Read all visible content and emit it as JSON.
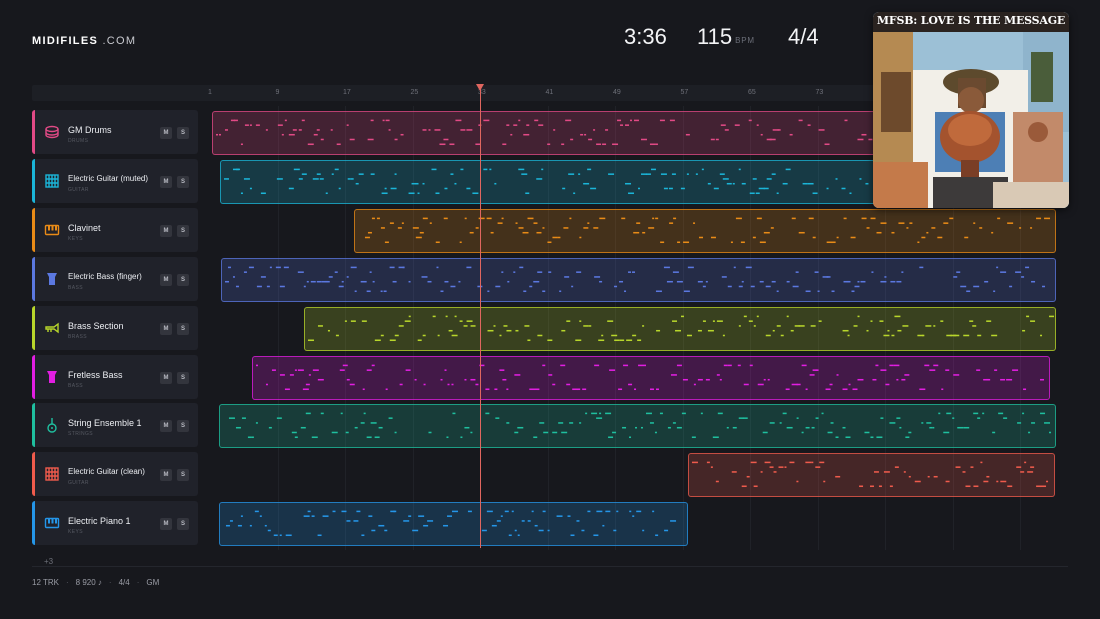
{
  "brand": {
    "name": "MIDIFILES",
    "tld": ".COM"
  },
  "transport": {
    "time": "3:36",
    "bpm": "115",
    "bpm_unit": "BPM",
    "time_signature": "4/4"
  },
  "ruler": {
    "ticks": [
      "1",
      "9",
      "17",
      "25",
      "33",
      "41",
      "49",
      "57",
      "65",
      "73"
    ]
  },
  "playhead": {
    "bar": 33
  },
  "tracks": [
    {
      "name": "GM Drums",
      "category": "DRUMS",
      "color": "#e24a86",
      "icon": "drum-icon",
      "mute": "M",
      "solo": "S"
    },
    {
      "name": "Electric Guitar (muted)",
      "category": "GUITAR",
      "color": "#1bb5d8",
      "icon": "guitar-icon",
      "mute": "M",
      "solo": "S"
    },
    {
      "name": "Clavinet",
      "category": "KEYS",
      "color": "#e98b17",
      "icon": "keys-icon",
      "mute": "M",
      "solo": "S"
    },
    {
      "name": "Electric Bass (finger)",
      "category": "BASS",
      "color": "#5b78e0",
      "icon": "bass-icon",
      "mute": "M",
      "solo": "S"
    },
    {
      "name": "Brass Section",
      "category": "BRASS",
      "color": "#b8d62b",
      "icon": "trumpet-icon",
      "mute": "M",
      "solo": "S"
    },
    {
      "name": "Fretless Bass",
      "category": "BASS",
      "color": "#e21ee2",
      "icon": "bass-icon",
      "mute": "M",
      "solo": "S"
    },
    {
      "name": "String Ensemble 1",
      "category": "STRINGS",
      "color": "#1fbf9f",
      "icon": "violin-icon",
      "mute": "M",
      "solo": "S"
    },
    {
      "name": "Electric Guitar (clean)",
      "category": "GUITAR",
      "color": "#ef5b4c",
      "icon": "guitar-icon",
      "mute": "M",
      "solo": "S"
    },
    {
      "name": "Electric Piano 1",
      "category": "KEYS",
      "color": "#2596e8",
      "icon": "keys-icon",
      "mute": "M",
      "solo": "S"
    }
  ],
  "more_tracks": "+3",
  "footer": {
    "tracks": "12 TRK",
    "notes": "8 920 ♪",
    "time_signature": "4/4",
    "standard": "GM"
  },
  "album": {
    "title": "MFSB: LOVE IS THE MESSAGE"
  }
}
